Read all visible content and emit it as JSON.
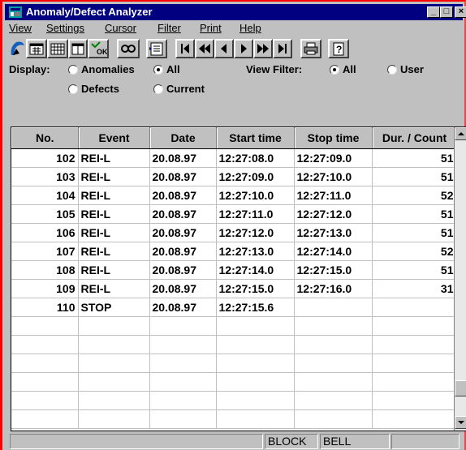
{
  "window": {
    "title": "Anomaly/Defect Analyzer",
    "icon": "app-icon",
    "controls": [
      "minimize-icon",
      "maximize-icon",
      "close-icon"
    ]
  },
  "menu": [
    "View",
    "Settings",
    "Cursor",
    "Filter",
    "Print",
    "Help"
  ],
  "toolbar": {
    "icons": [
      "app-logo-icon",
      "calendar-icon",
      "grid-icon",
      "window-icon",
      "ok-icon",
      "find-icon",
      "list-icon",
      "first-icon",
      "rewind-icon",
      "prev-icon",
      "next-icon",
      "fast-forward-icon",
      "last-icon",
      "print-icon",
      "help-icon"
    ]
  },
  "display": {
    "label": "Display:",
    "options": [
      "Anomalies",
      "All",
      "Defects",
      "Current"
    ],
    "selected": "All"
  },
  "view_filter": {
    "label": "View Filter:",
    "options": [
      "All",
      "User"
    ],
    "selected": "All"
  },
  "table": {
    "columns": [
      "No.",
      "Event",
      "Date",
      "Start time",
      "Stop time",
      "Dur. / Count"
    ],
    "rows": [
      [
        "102",
        "REI-L",
        "20.08.97",
        "12:27:08.0",
        "12:27:09.0",
        "51"
      ],
      [
        "103",
        "REI-L",
        "20.08.97",
        "12:27:09.0",
        "12:27:10.0",
        "51"
      ],
      [
        "104",
        "REI-L",
        "20.08.97",
        "12:27:10.0",
        "12:27:11.0",
        "52"
      ],
      [
        "105",
        "REI-L",
        "20.08.97",
        "12:27:11.0",
        "12:27:12.0",
        "51"
      ],
      [
        "106",
        "REI-L",
        "20.08.97",
        "12:27:12.0",
        "12:27:13.0",
        "51"
      ],
      [
        "107",
        "REI-L",
        "20.08.97",
        "12:27:13.0",
        "12:27:14.0",
        "52"
      ],
      [
        "108",
        "REI-L",
        "20.08.97",
        "12:27:14.0",
        "12:27:15.0",
        "51"
      ],
      [
        "109",
        "REI-L",
        "20.08.97",
        "12:27:15.0",
        "12:27:16.0",
        "31"
      ],
      [
        "110",
        "STOP",
        "20.08.97",
        "12:27:15.6",
        "",
        ""
      ]
    ]
  },
  "status": {
    "block": "BLOCK",
    "bell": "BELL"
  },
  "colors": {
    "titlebar": "#000080",
    "face": "#c0c0c0",
    "frame": "#ff0000"
  }
}
